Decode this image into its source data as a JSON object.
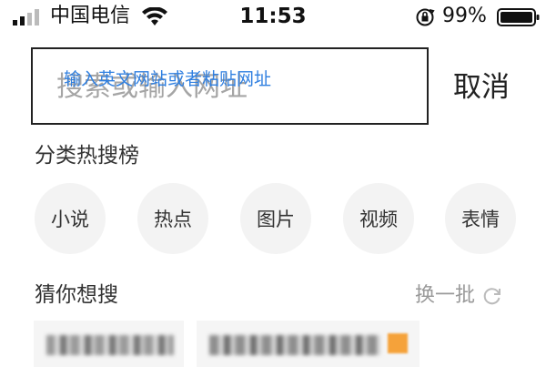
{
  "status_bar": {
    "carrier": "中国电信",
    "time": "11:53",
    "battery_percent": "99%",
    "icons": [
      "signal-icon",
      "wifi-icon",
      "rotation-lock-icon",
      "battery-icon"
    ]
  },
  "search": {
    "placeholder": "搜索或输入网址",
    "hint_overlay": "输入英文网站或者粘贴网址",
    "cancel_label": "取消"
  },
  "categories": {
    "title": "分类热搜榜",
    "items": [
      {
        "label": "小说"
      },
      {
        "label": "热点"
      },
      {
        "label": "图片"
      },
      {
        "label": "视频"
      },
      {
        "label": "表情"
      }
    ]
  },
  "guess": {
    "title": "猜你想搜",
    "refresh_label": "换一批"
  },
  "colors": {
    "accent_blue": "#2f7fe0",
    "bubble_bg": "#f3f3f3",
    "tag_orange": "#f5a23a"
  }
}
